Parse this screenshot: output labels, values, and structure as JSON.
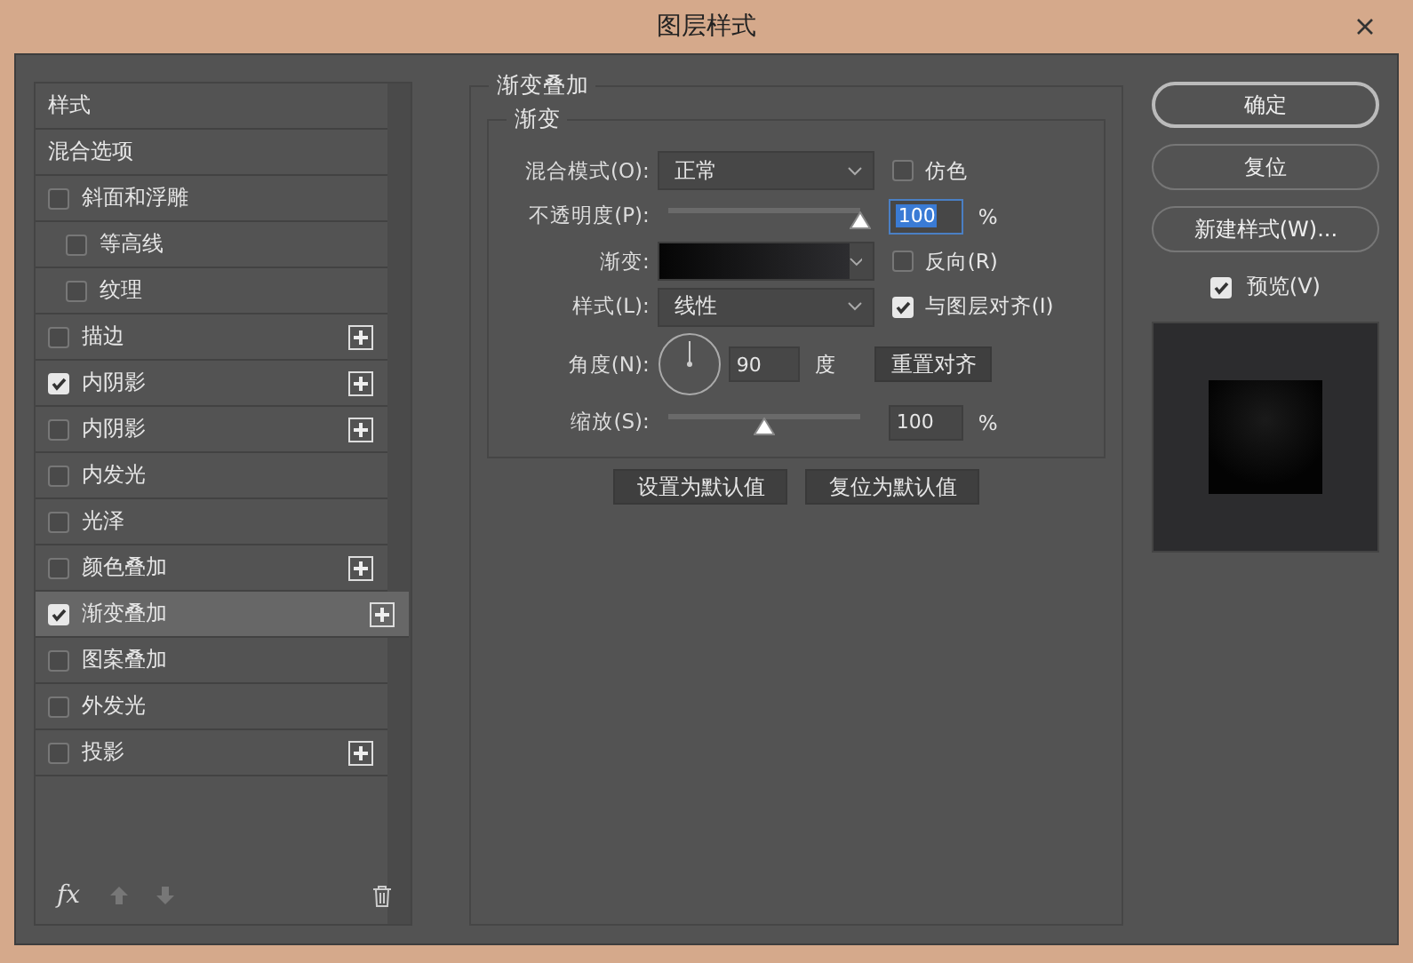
{
  "window": {
    "title": "图层样式"
  },
  "sidebar": {
    "items": [
      {
        "kind": "header",
        "label": "样式",
        "selected": false
      },
      {
        "kind": "header",
        "label": "混合选项",
        "selected": false
      },
      {
        "kind": "check",
        "label": "斜面和浮雕",
        "checked": false,
        "add_button": false,
        "selected": false,
        "children": [
          {
            "kind": "check",
            "label": "等高线",
            "checked": false,
            "add_button": false,
            "selected": false
          },
          {
            "kind": "check",
            "label": "纹理",
            "checked": false,
            "add_button": false,
            "selected": false
          }
        ]
      },
      {
        "kind": "check",
        "label": "描边",
        "checked": false,
        "add_button": true,
        "selected": false
      },
      {
        "kind": "check",
        "label": "内阴影",
        "checked": true,
        "add_button": true,
        "selected": false
      },
      {
        "kind": "check",
        "label": "内阴影",
        "checked": false,
        "add_button": true,
        "selected": false
      },
      {
        "kind": "check",
        "label": "内发光",
        "checked": false,
        "add_button": false,
        "selected": false
      },
      {
        "kind": "check",
        "label": "光泽",
        "checked": false,
        "add_button": false,
        "selected": false
      },
      {
        "kind": "check",
        "label": "颜色叠加",
        "checked": false,
        "add_button": true,
        "selected": false
      },
      {
        "kind": "check",
        "label": "渐变叠加",
        "checked": true,
        "add_button": true,
        "selected": true
      },
      {
        "kind": "check",
        "label": "图案叠加",
        "checked": false,
        "add_button": false,
        "selected": false
      },
      {
        "kind": "check",
        "label": "外发光",
        "checked": false,
        "add_button": false,
        "selected": false
      },
      {
        "kind": "check",
        "label": "投影",
        "checked": false,
        "add_button": true,
        "selected": false
      }
    ],
    "effects_button": "fx"
  },
  "panel": {
    "title": "渐变叠加",
    "group_title": "渐变",
    "blend_mode": {
      "label": "混合模式(O):",
      "value": "正常"
    },
    "dither": {
      "label": "仿色",
      "checked": false
    },
    "opacity": {
      "label": "不透明度(P):",
      "level": 1,
      "value": "100",
      "unit": "%"
    },
    "gradient": {
      "label": "渐变:"
    },
    "reverse": {
      "label": "反向(R)",
      "checked": false
    },
    "style": {
      "label": "样式(L):",
      "value": "线性"
    },
    "align": {
      "label": "与图层对齐(I)",
      "checked": true
    },
    "angle": {
      "label": "角度(N):",
      "value": "90",
      "unit": "度"
    },
    "reset_align_button": "重置对齐",
    "scale": {
      "label": "缩放(S):",
      "level": 0.5,
      "value": "100",
      "unit": "%"
    },
    "buttons": [
      "设置为默认值",
      "复位为默认值"
    ]
  },
  "actions": {
    "buttons": [
      {
        "label": "确定",
        "default": true
      },
      {
        "label": "复位",
        "default": false
      },
      {
        "label": "新建样式(W)...",
        "default": false
      }
    ],
    "preview": {
      "label": "预览(V)",
      "checked": true
    }
  }
}
